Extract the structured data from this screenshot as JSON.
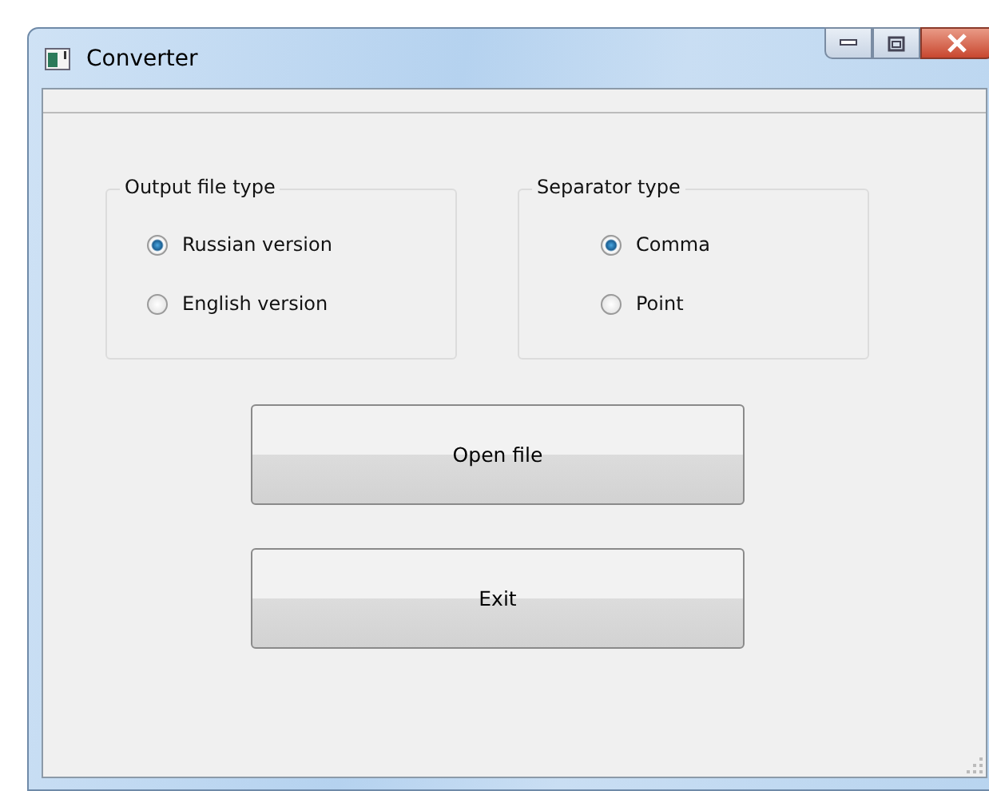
{
  "window": {
    "title": "Converter"
  },
  "groups": [
    {
      "title": "Output file type",
      "options": [
        {
          "label": "Russian version",
          "selected": true
        },
        {
          "label": "English version",
          "selected": false
        }
      ]
    },
    {
      "title": "Separator type",
      "options": [
        {
          "label": "Comma",
          "selected": true
        },
        {
          "label": "Point",
          "selected": false
        }
      ]
    }
  ],
  "buttons": [
    "Open file",
    "Exit"
  ]
}
